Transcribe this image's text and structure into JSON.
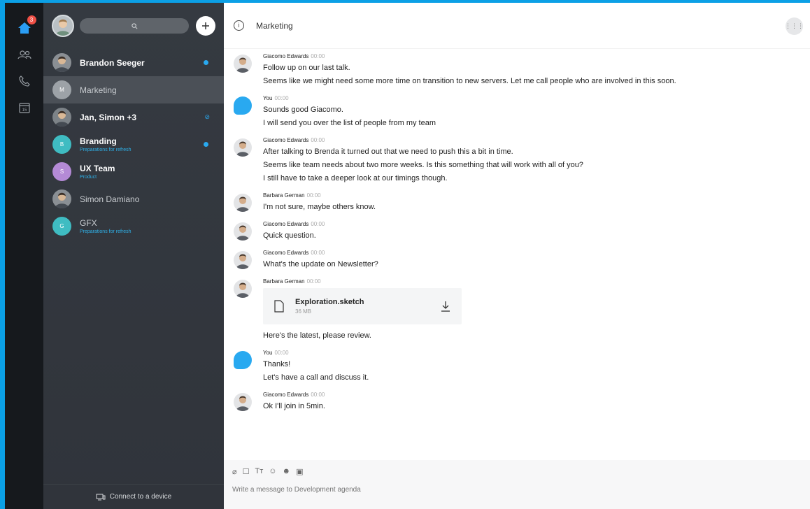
{
  "colors": {
    "accent": "#29a9f0",
    "badge": "#f05046",
    "rail": "#16191d",
    "sidebar": "#353a41"
  },
  "rail": {
    "home_badge": "3",
    "calendar_day": "15"
  },
  "sidebar": {
    "conversations": [
      {
        "name": "Brandon Seeger",
        "sub": "",
        "initial": "",
        "avatar_color": "#8a8f94",
        "unread": true,
        "muted": false,
        "bold": true,
        "active": false
      },
      {
        "name": "Marketing",
        "sub": "",
        "initial": "M",
        "avatar_color": "#9da2a7",
        "unread": false,
        "muted": false,
        "bold": false,
        "active": true
      },
      {
        "name": "Jan, Simon +3",
        "sub": "",
        "initial": "",
        "avatar_color": "#7d8388",
        "unread": false,
        "muted": true,
        "bold": true,
        "active": false
      },
      {
        "name": "Branding",
        "sub": "Preparations for refresh",
        "initial": "B",
        "avatar_color": "#3fbcc2",
        "unread": true,
        "muted": false,
        "bold": true,
        "active": false
      },
      {
        "name": "UX Team",
        "sub": "Product",
        "initial": "S",
        "avatar_color": "#b48ad6",
        "unread": false,
        "muted": false,
        "bold": true,
        "active": false
      },
      {
        "name": "Simon Damiano",
        "sub": "",
        "initial": "",
        "avatar_color": "#8a8f94",
        "unread": false,
        "muted": false,
        "bold": false,
        "active": false
      },
      {
        "name": "GFX",
        "sub": "Preparations for refresh",
        "initial": "G",
        "avatar_color": "#3fbcc2",
        "unread": false,
        "muted": false,
        "bold": false,
        "active": false
      }
    ],
    "connect_label": "Connect to a device"
  },
  "header": {
    "title": "Marketing"
  },
  "messages": [
    {
      "author": "Giacomo Edwards",
      "time": "00:00",
      "you": false,
      "lines": [
        "Follow up on our last talk.",
        "Seems like we might need some more time on transition to new servers. Let me call people who are involved in this soon."
      ]
    },
    {
      "author": "You",
      "time": "00:00",
      "you": true,
      "lines": [
        "Sounds good Giacomo.",
        "I will send you over the list of people from my team"
      ]
    },
    {
      "author": "Giacomo Edwards",
      "time": "00:00",
      "you": false,
      "lines": [
        "After talking to Brenda it turned out that we need to push this a bit in time.",
        "Seems like team needs about two more weeks. Is this something that will work with all of you?",
        "I still have to take a deeper look at our timings though."
      ]
    },
    {
      "author": "Barbara German",
      "time": "00:00",
      "you": false,
      "lines": [
        "I'm not sure, maybe others know."
      ]
    },
    {
      "author": "Giacomo Edwards",
      "time": "00:00",
      "you": false,
      "lines": [
        "Quick question."
      ]
    },
    {
      "author": "Giacomo Edwards",
      "time": "00:00",
      "you": false,
      "lines": [
        "What's the update on Newsletter?"
      ]
    },
    {
      "author": "Barbara German",
      "time": "00:00",
      "you": false,
      "file": {
        "name": "Exploration.sketch",
        "size": "36 MB"
      },
      "lines": [
        "Here's the latest, please review."
      ]
    },
    {
      "author": "You",
      "time": "00:00",
      "you": true,
      "lines": [
        "Thanks!",
        "Let's have a call and discuss it."
      ]
    },
    {
      "author": "Giacomo Edwards",
      "time": "00:00",
      "you": false,
      "lines": [
        "Ok I'll join in 5min."
      ]
    }
  ],
  "composer": {
    "placeholder": "Write a message to Development agenda"
  }
}
